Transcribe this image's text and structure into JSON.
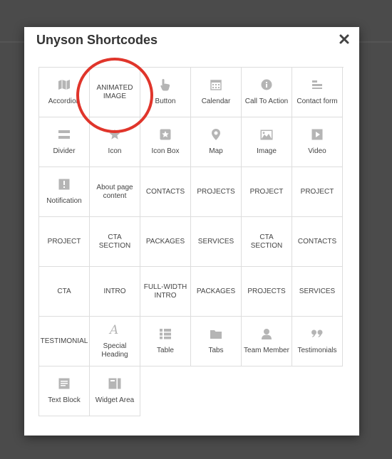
{
  "modal": {
    "title": "Unyson Shortcodes",
    "close_icon": "close-icon"
  },
  "shortcodes": [
    {
      "label": "Accordion",
      "icon": "map-icon"
    },
    {
      "label": "ANIMATED IMAGE",
      "icon": ""
    },
    {
      "label": "Button",
      "icon": "pointer-hand-icon"
    },
    {
      "label": "Calendar",
      "icon": "calendar-icon"
    },
    {
      "label": "Call To Action",
      "icon": "info-icon"
    },
    {
      "label": "Contact form",
      "icon": "form-icon"
    },
    {
      "label": "Divider",
      "icon": "divider-icon"
    },
    {
      "label": "Icon",
      "icon": "star-icon"
    },
    {
      "label": "Icon Box",
      "icon": "star-box-icon"
    },
    {
      "label": "Map",
      "icon": "map-pin-icon"
    },
    {
      "label": "Image",
      "icon": "image-icon"
    },
    {
      "label": "Video",
      "icon": "video-icon"
    },
    {
      "label": "Notification",
      "icon": "notification-icon"
    },
    {
      "label": "About page content",
      "icon": ""
    },
    {
      "label": "CONTACTS",
      "icon": ""
    },
    {
      "label": "PROJECTS",
      "icon": ""
    },
    {
      "label": "PROJECT",
      "icon": ""
    },
    {
      "label": "PROJECT",
      "icon": ""
    },
    {
      "label": "PROJECT",
      "icon": ""
    },
    {
      "label": "CTA SECTION",
      "icon": ""
    },
    {
      "label": "PACKAGES",
      "icon": ""
    },
    {
      "label": "SERVICES",
      "icon": ""
    },
    {
      "label": "CTA SECTION",
      "icon": ""
    },
    {
      "label": "CONTACTS",
      "icon": ""
    },
    {
      "label": "CTA",
      "icon": ""
    },
    {
      "label": "INTRO",
      "icon": ""
    },
    {
      "label": "FULL-WIDTH INTRO",
      "icon": ""
    },
    {
      "label": "PACKAGES",
      "icon": ""
    },
    {
      "label": "PROJECTS",
      "icon": ""
    },
    {
      "label": "SERVICES",
      "icon": ""
    },
    {
      "label": "TESTIMONIAL",
      "icon": ""
    },
    {
      "label": "Special Heading",
      "icon": "script-a-icon"
    },
    {
      "label": "Table",
      "icon": "table-icon"
    },
    {
      "label": "Tabs",
      "icon": "folder-icon"
    },
    {
      "label": "Team Member",
      "icon": "user-icon"
    },
    {
      "label": "Testimonials",
      "icon": "quote-icon"
    },
    {
      "label": "Text Block",
      "icon": "text-block-icon"
    },
    {
      "label": "Widget Area",
      "icon": "widget-icon"
    }
  ],
  "annotation_color": "#e0352b"
}
